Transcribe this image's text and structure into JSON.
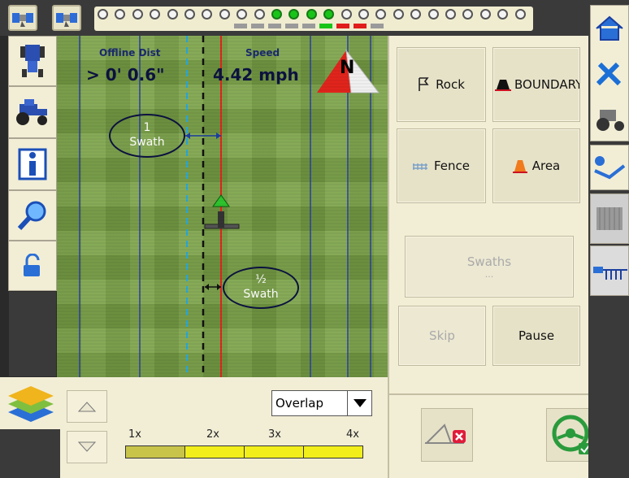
{
  "map": {
    "offline_dist_label": "Offline Dist",
    "offline_dist_value": "> 0' 0.6\"",
    "speed_label": "Speed",
    "speed_value": "4.42 mph",
    "compass_letter": "N",
    "swath_full_num": "1",
    "swath_full_label": "Swath",
    "swath_half_num": "½",
    "swath_half_label": "Swath"
  },
  "status_bar": {
    "leds_on": [
      10,
      11,
      12,
      13
    ],
    "sections": [
      "gray",
      "gray",
      "gray",
      "gray",
      "gray",
      "green",
      "red",
      "red",
      "gray"
    ],
    "led_count": 25
  },
  "left_toolbar": {
    "icons": [
      "tractor-top-icon",
      "tractor-icon",
      "info-icon",
      "search-icon",
      "unlock-icon"
    ]
  },
  "bottom": {
    "overlap_select": "Overlap",
    "scale_labels": [
      "1x",
      "2x",
      "3x",
      "4x"
    ]
  },
  "right_panel": {
    "rock_label": "Rock",
    "boundary_label": "BOUNDARY",
    "fence_label": "Fence",
    "area_label": "Area",
    "swaths_label": "Swaths",
    "swaths_value": "...",
    "skip_label": "Skip",
    "pause_label": "Pause"
  },
  "colors": {
    "guidance_red": "#e0241c",
    "swath_blue": "#2a3f9e",
    "led_on": "#19c419",
    "panel_bg": "#f2eed6"
  }
}
